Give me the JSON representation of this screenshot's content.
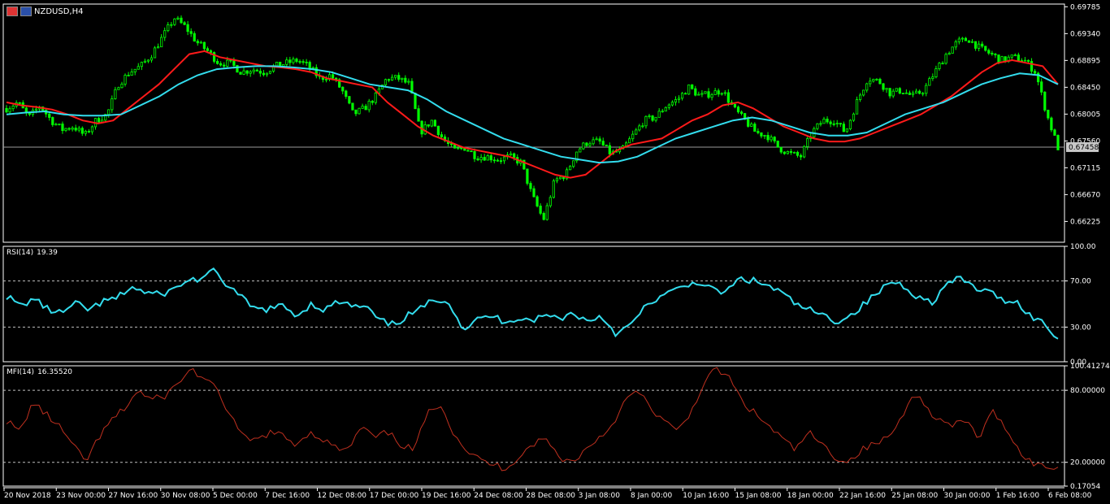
{
  "symbol": "NZDUSD,H4",
  "price_flags": [
    "nz-flag-icon",
    "us-flag-icon"
  ],
  "colors": {
    "background": "#000000",
    "candle": "#00ff00",
    "ma_fast": "#ff1a1a",
    "ma_slow": "#33ddee",
    "rsi": "#33ddee",
    "mfi": "#c0301f",
    "axis": "#ffffff",
    "level_line": "#bfbfbf"
  },
  "rsi_label": {
    "name": "RSI(14)",
    "value": "19.39"
  },
  "mfi_label": {
    "name": "MFI(14)",
    "value": "16.35520"
  },
  "current_price_tag": "0.67458",
  "chart_data": [
    {
      "type": "candlestick",
      "title": "NZDUSD,H4",
      "y_ticks": [
        "0.69785",
        "0.69340",
        "0.68895",
        "0.68450",
        "0.68005",
        "0.67560",
        "0.67115",
        "0.66670",
        "0.66225"
      ],
      "ylim": [
        0.6588,
        0.6983
      ],
      "current_price": 0.67458,
      "x_tick_labels": [
        "20 Nov 2018",
        "23 Nov 00:00",
        "27 Nov 16:00",
        "30 Nov 08:00",
        "5 Dec 00:00",
        "7 Dec 16:00",
        "12 Dec 08:00",
        "17 Dec 00:00",
        "19 Dec 16:00",
        "24 Dec 08:00",
        "28 Dec 08:00",
        "3 Jan 08:00",
        "8 Jan 00:00",
        "10 Jan 16:00",
        "15 Jan 08:00",
        "18 Jan 00:00",
        "22 Jan 16:00",
        "25 Jan 08:00",
        "30 Jan 00:00",
        "1 Feb 16:00",
        "6 Feb 08:00"
      ],
      "close_path": [
        0.681,
        0.682,
        0.6795,
        0.6815,
        0.679,
        0.6775,
        0.678,
        0.6765,
        0.679,
        0.68,
        0.685,
        0.687,
        0.688,
        0.69,
        0.693,
        0.696,
        0.6945,
        0.692,
        0.6905,
        0.6885,
        0.6885,
        0.687,
        0.6875,
        0.687,
        0.688,
        0.6885,
        0.689,
        0.688,
        0.686,
        0.6865,
        0.684,
        0.68,
        0.681,
        0.683,
        0.686,
        0.686,
        0.685,
        0.677,
        0.679,
        0.676,
        0.674,
        0.6745,
        0.673,
        0.673,
        0.6725,
        0.673,
        0.672,
        0.6665,
        0.6625,
        0.669,
        0.67,
        0.674,
        0.6755,
        0.6755,
        0.6735,
        0.674,
        0.6765,
        0.679,
        0.6795,
        0.6815,
        0.6825,
        0.6845,
        0.683,
        0.6835,
        0.684,
        0.681,
        0.679,
        0.677,
        0.6765,
        0.6745,
        0.6735,
        0.673,
        0.677,
        0.679,
        0.679,
        0.677,
        0.682,
        0.686,
        0.6855,
        0.6835,
        0.684,
        0.683,
        0.684,
        0.687,
        0.69,
        0.692,
        0.6925,
        0.691,
        0.69,
        0.689,
        0.6895,
        0.689,
        0.687,
        0.68,
        0.6745
      ],
      "series": [
        {
          "name": "MA fast",
          "values": [
            0.682,
            0.6815,
            0.6812,
            0.6808,
            0.68,
            0.679,
            0.6785,
            0.679,
            0.681,
            0.683,
            0.685,
            0.6875,
            0.69,
            0.6905,
            0.6895,
            0.689,
            0.6885,
            0.688,
            0.6878,
            0.6875,
            0.687,
            0.686,
            0.6855,
            0.685,
            0.6845,
            0.682,
            0.68,
            0.678,
            0.6765,
            0.6755,
            0.6745,
            0.674,
            0.6735,
            0.673,
            0.672,
            0.671,
            0.67,
            0.6695,
            0.67,
            0.672,
            0.674,
            0.675,
            0.6755,
            0.676,
            0.6775,
            0.679,
            0.68,
            0.6815,
            0.682,
            0.681,
            0.6795,
            0.678,
            0.677,
            0.676,
            0.6755,
            0.6755,
            0.676,
            0.677,
            0.678,
            0.679,
            0.68,
            0.6815,
            0.683,
            0.685,
            0.687,
            0.6885,
            0.689,
            0.6885,
            0.688,
            0.685
          ]
        },
        {
          "name": "MA slow",
          "values": [
            0.68,
            0.6803,
            0.6805,
            0.68,
            0.6798,
            0.6798,
            0.68,
            0.6815,
            0.683,
            0.685,
            0.6865,
            0.6875,
            0.6878,
            0.688,
            0.688,
            0.6878,
            0.6875,
            0.687,
            0.686,
            0.685,
            0.6845,
            0.684,
            0.6825,
            0.6805,
            0.679,
            0.6775,
            0.676,
            0.675,
            0.674,
            0.673,
            0.6725,
            0.672,
            0.6722,
            0.673,
            0.6745,
            0.676,
            0.677,
            0.678,
            0.679,
            0.6795,
            0.679,
            0.678,
            0.677,
            0.6765,
            0.6765,
            0.677,
            0.6785,
            0.68,
            0.681,
            0.682,
            0.6835,
            0.685,
            0.686,
            0.6868,
            0.6865,
            0.685
          ]
        }
      ]
    },
    {
      "type": "line",
      "title": "RSI(14) 19.39",
      "y_ticks": [
        "100.00",
        "70.00",
        "30.00",
        "0.00"
      ],
      "ylim": [
        0,
        100
      ],
      "levels": [
        70,
        30
      ],
      "series": [
        {
          "name": "RSI(14)",
          "values": [
            57,
            48,
            55,
            45,
            42,
            50,
            45,
            52,
            55,
            65,
            60,
            58,
            62,
            70,
            72,
            78,
            66,
            55,
            45,
            46,
            48,
            40,
            50,
            45,
            52,
            48,
            47,
            35,
            32,
            40,
            46,
            55,
            52,
            28,
            36,
            40,
            35,
            38,
            36,
            40,
            38,
            42,
            35,
            40,
            25,
            30,
            45,
            55,
            60,
            65,
            70,
            62,
            60,
            72,
            70,
            66,
            60,
            50,
            45,
            40,
            35,
            40,
            50,
            60,
            70,
            65,
            55,
            52,
            68,
            72,
            64,
            60,
            54,
            52,
            40,
            33,
            20
          ]
        }
      ]
    },
    {
      "type": "line",
      "title": "MFI(14) 16.35520",
      "y_ticks": [
        "100.41274",
        "80.00000",
        "20.00000",
        "0.17054"
      ],
      "ylim": [
        0.17054,
        100.41274
      ],
      "levels": [
        80,
        20
      ],
      "series": [
        {
          "name": "MFI(14)",
          "values": [
            55,
            45,
            70,
            60,
            50,
            35,
            20,
            40,
            55,
            65,
            80,
            72,
            75,
            85,
            98,
            90,
            80,
            60,
            40,
            38,
            45,
            42,
            35,
            45,
            40,
            32,
            30,
            50,
            40,
            45,
            35,
            30,
            60,
            70,
            45,
            30,
            22,
            18,
            15,
            25,
            35,
            40,
            25,
            20,
            30,
            40,
            50,
            70,
            80,
            65,
            55,
            45,
            60,
            85,
            98,
            90,
            70,
            60,
            50,
            40,
            30,
            45,
            35,
            25,
            20,
            30,
            35,
            40,
            55,
            80,
            65,
            55,
            50,
            55,
            40,
            62,
            50,
            30,
            20,
            16,
            16
          ]
        }
      ]
    }
  ]
}
